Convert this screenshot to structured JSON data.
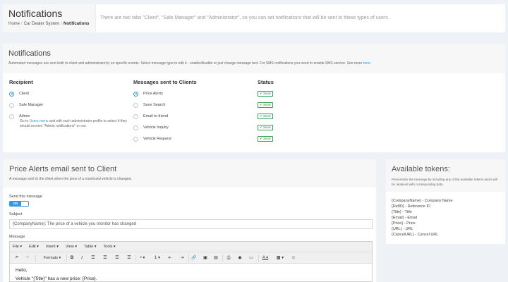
{
  "header": {
    "title": "Notifications",
    "breadcrumb": [
      "Home",
      "Car Dealer System",
      "Notifications"
    ],
    "description": "There are two tabs \"Client\", \"Sale Manager\" and \"Administrator\", so you can set notifications that will be sent to these types of users."
  },
  "notifications": {
    "title": "Notifications",
    "note_text": "Automated messages are sent both to client and administrator(s) on specific events. Select message type to edit it - enable/disable or just change message text. For SMS notifications you need to enable SMS service. See more ",
    "note_link": "here",
    "note_end": ".",
    "recipient_header": "Recipient",
    "recipients": [
      {
        "label": "Client",
        "checked": true
      },
      {
        "label": "Sale Manager",
        "checked": false
      },
      {
        "label": "Admin",
        "checked": false
      }
    ],
    "admin_note_pre": "Go to ",
    "admin_note_link": "Users menu",
    "admin_note_post": " and edit each administrator profile to select if they should receive \"Admin notifications\" or not.",
    "messages_header": "Messages sent to Clients",
    "messages": [
      {
        "label": "Price Alerts",
        "checked": true
      },
      {
        "label": "Save Search",
        "checked": false
      },
      {
        "label": "Email to friend",
        "checked": false
      },
      {
        "label": "Vehicle Inquiry",
        "checked": false
      },
      {
        "label": "Vehicle Request",
        "checked": false
      }
    ],
    "status_header": "Status",
    "status_label": "✔ Send",
    "status_color": "#36a35a"
  },
  "price_alerts": {
    "title": "Price Alerts email sent to Client",
    "subtitle": "A message sent to the client when the price of a monitored vehicle is changed.",
    "send_label": "Send this message",
    "toggle_label": "ON",
    "subject_label": "Subject",
    "subject_value": "{CompanyName}: The price of a vehicle you monitor has changed",
    "message_label": "Message",
    "editor_menu": [
      "File ▾",
      "Edit ▾",
      "Insert ▾",
      "View ▾",
      "Table ▾",
      "Tools ▾"
    ],
    "formats_label": "Formats ▾",
    "body_lines": [
      "Hello,",
      "Vehicle \"{Title}\" has a new price: {Price}."
    ]
  },
  "tokens": {
    "title": "Available tokens:",
    "description": "Personalize the message by including any of the available tokens and it will be replaced with corresponding data.",
    "items": [
      "{CompanyName} - Company Name",
      "{RefID} - Reference ID",
      "{Title} - Title",
      "{Email} - Email",
      "{Price} - Price",
      "{URL} - URL",
      "{CancelURL} - Cancel URL"
    ]
  },
  "colors": {
    "accent": "#3598dc",
    "success": "#36a35a"
  }
}
